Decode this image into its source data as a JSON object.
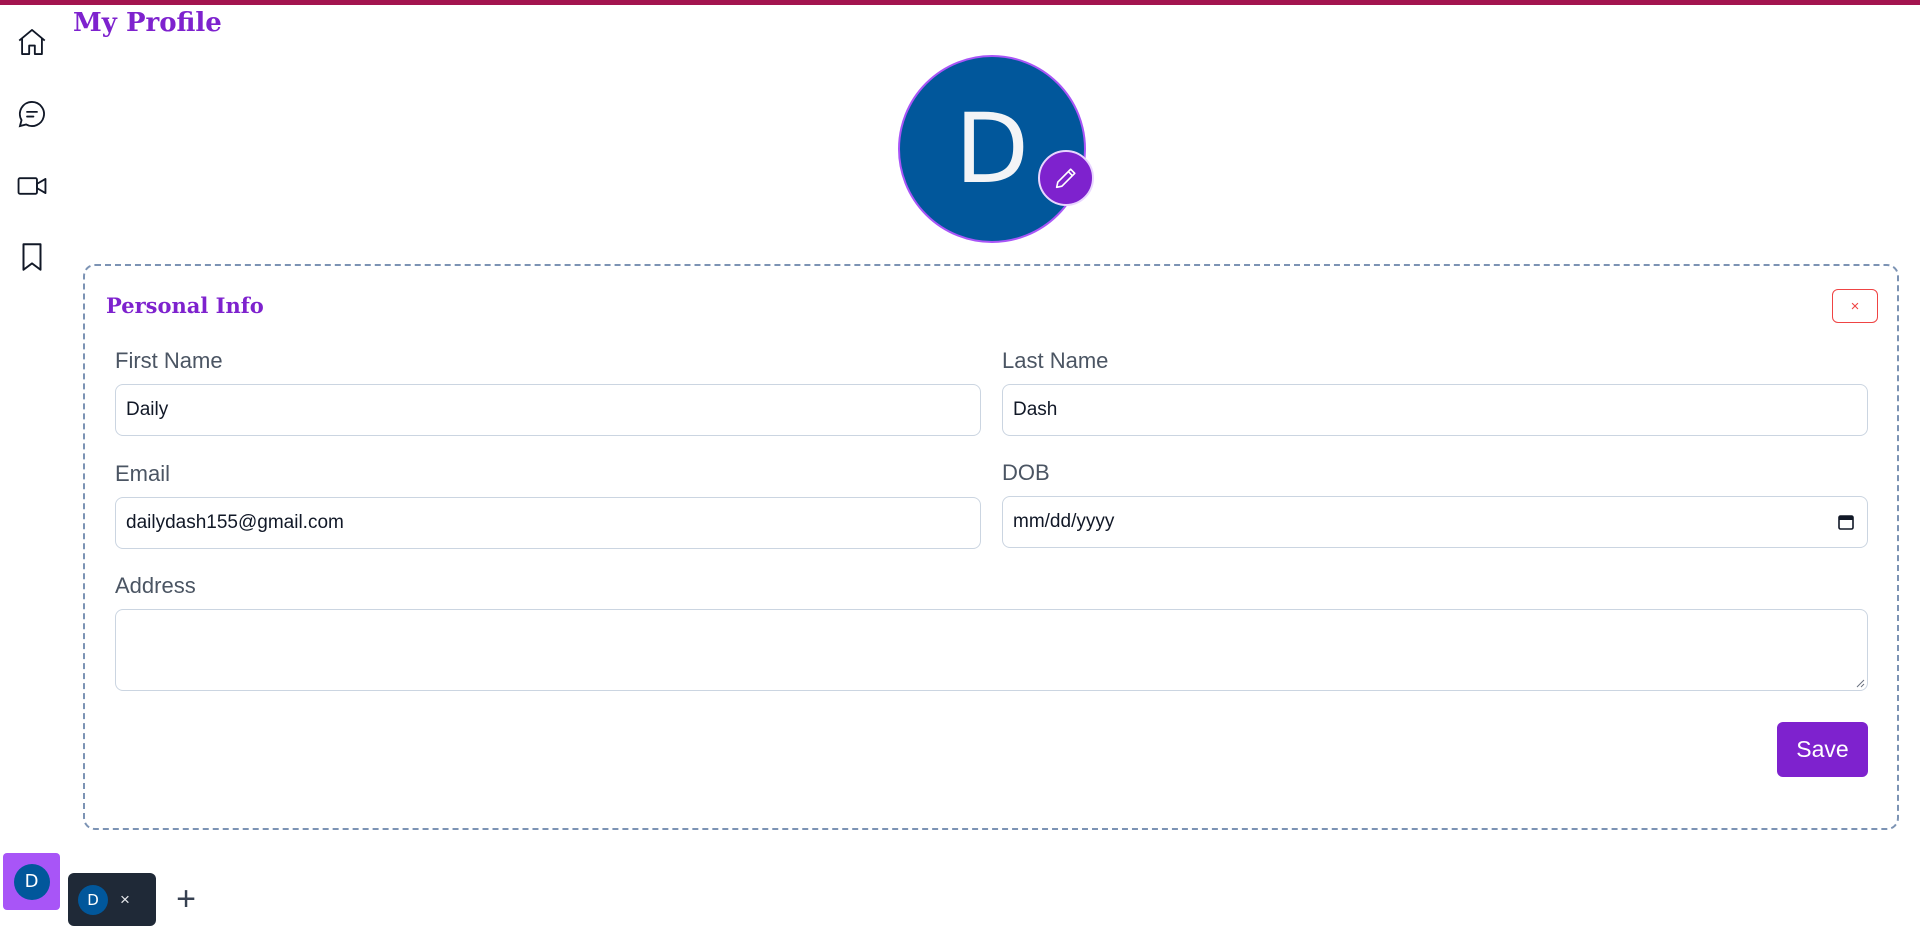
{
  "header": {
    "title": "My Profile"
  },
  "sidebar": {
    "items": [
      {
        "name": "home",
        "icon": "home-icon"
      },
      {
        "name": "chat",
        "icon": "chat-icon"
      },
      {
        "name": "video",
        "icon": "video-camera-icon"
      },
      {
        "name": "bookmark",
        "icon": "bookmark-icon"
      }
    ]
  },
  "profile": {
    "avatar_initial": "D"
  },
  "personal_info": {
    "title": "Personal Info",
    "close_label": "×",
    "first_name_label": "First Name",
    "first_name_value": "Daily",
    "last_name_label": "Last Name",
    "last_name_value": "Dash",
    "email_label": "Email",
    "email_value": "dailydash155@gmail.com",
    "dob_label": "DOB",
    "dob_placeholder": "mm/dd/yyyy",
    "address_label": "Address",
    "address_value": "",
    "save_label": "Save"
  },
  "bottom": {
    "profile_initial": "D",
    "tabs": [
      {
        "initial": "D",
        "close": "×"
      }
    ],
    "add_label": "+"
  },
  "colors": {
    "accent": "#7e22ce",
    "topbar": "#a3144f",
    "avatar_bg": "#01579b",
    "danger": "#ef4444"
  }
}
